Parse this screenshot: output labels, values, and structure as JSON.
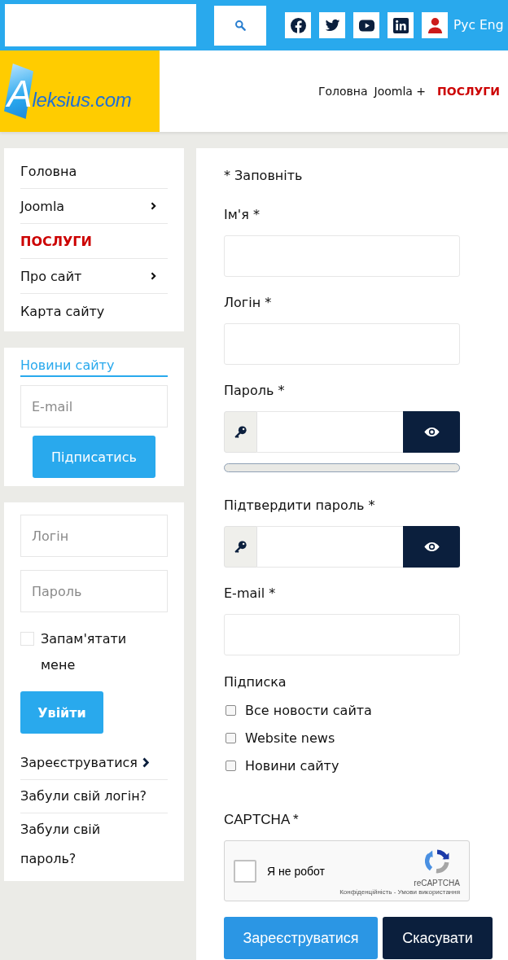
{
  "top_bar": {
    "languages": [
      "Рус",
      "Eng"
    ]
  },
  "header": {
    "logo": "Aleksius.com",
    "nav": [
      {
        "label": "Головна",
        "selected": false
      },
      {
        "label": "Joomla +",
        "selected": false
      },
      {
        "label": "ПОСЛУГИ",
        "selected": true
      }
    ]
  },
  "sidebar": {
    "menu": [
      {
        "label": "Головна",
        "selected": false,
        "expandable": false
      },
      {
        "label": "Joomla",
        "selected": false,
        "expandable": true
      },
      {
        "label": "ПОСЛУГИ",
        "selected": true,
        "expandable": false
      },
      {
        "label": "Про сайт",
        "selected": false,
        "expandable": true
      },
      {
        "label": "Карта сайту",
        "selected": false,
        "expandable": false
      }
    ],
    "newsletter": {
      "title": "Новини сайту",
      "email": {
        "placeholder": "E-mail"
      },
      "button": "Підписатись"
    },
    "login": {
      "username": {
        "placeholder": "Логін"
      },
      "password": {
        "placeholder": "Пароль"
      },
      "remember": {
        "label": "Запам'ятати мене",
        "checked": false
      },
      "button": "Увійти",
      "links": [
        {
          "label": "Зареєструватися",
          "arrow": true
        },
        {
          "label": "Забули свій логін?",
          "arrow": false
        },
        {
          "label": "Забули свій пароль?",
          "arrow": false
        }
      ]
    }
  },
  "form": {
    "required_note": "* Заповніть",
    "fields": [
      {
        "kind": "text",
        "label": "Ім'я *"
      },
      {
        "kind": "text",
        "label": "Логін *"
      },
      {
        "kind": "password",
        "label": "Пароль *",
        "strength": {
          "level": 0
        }
      },
      {
        "kind": "password",
        "label": "Підтвердити пароль *"
      },
      {
        "kind": "text",
        "label": "E-mail *"
      }
    ],
    "subscription": {
      "label": "Підписка",
      "options": [
        {
          "label": "Все новости сайта",
          "checked": false
        },
        {
          "label": "Website news",
          "checked": false
        },
        {
          "label": "Новини сайту",
          "checked": false
        }
      ]
    },
    "captcha": {
      "label": "CAPTCHA *",
      "checkbox": {
        "label": "Я не робот",
        "checked": false
      },
      "brand": "reCAPTCHA",
      "terms": "Конфіденційність - Умови використання"
    },
    "buttons": [
      {
        "label": "Зареєструватися",
        "kind": "primary"
      },
      {
        "label": "Скасувати",
        "kind": "secondary"
      }
    ]
  }
}
